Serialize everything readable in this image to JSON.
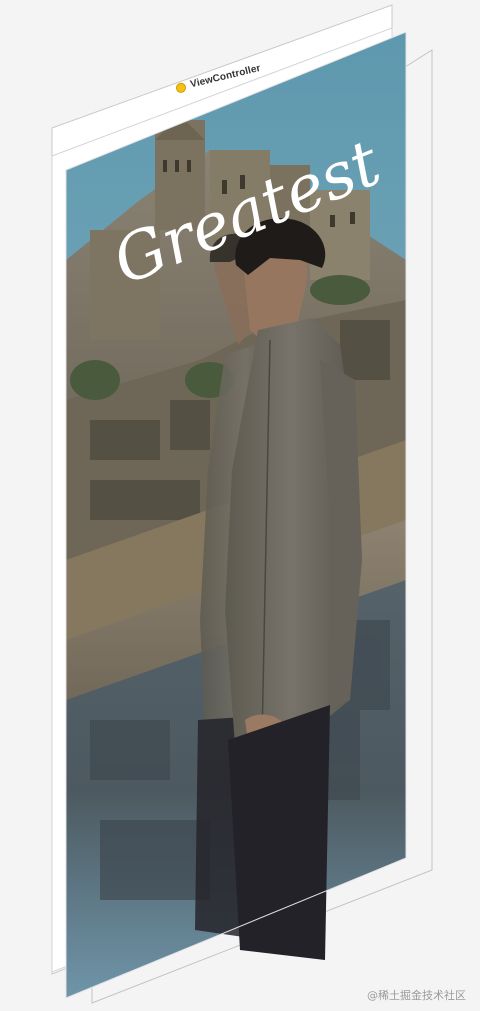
{
  "view_controller": {
    "title": "ViewController",
    "icon": "view-controller-icon",
    "icon_color": "#f3c212"
  },
  "overlay": {
    "text": "Greatest",
    "color": "#ffffff"
  },
  "watermark": {
    "text": "@稀土掘金技术社区"
  },
  "scene": {
    "sky_color": "#6fa3b8",
    "water_color": "#6b8fa4"
  }
}
